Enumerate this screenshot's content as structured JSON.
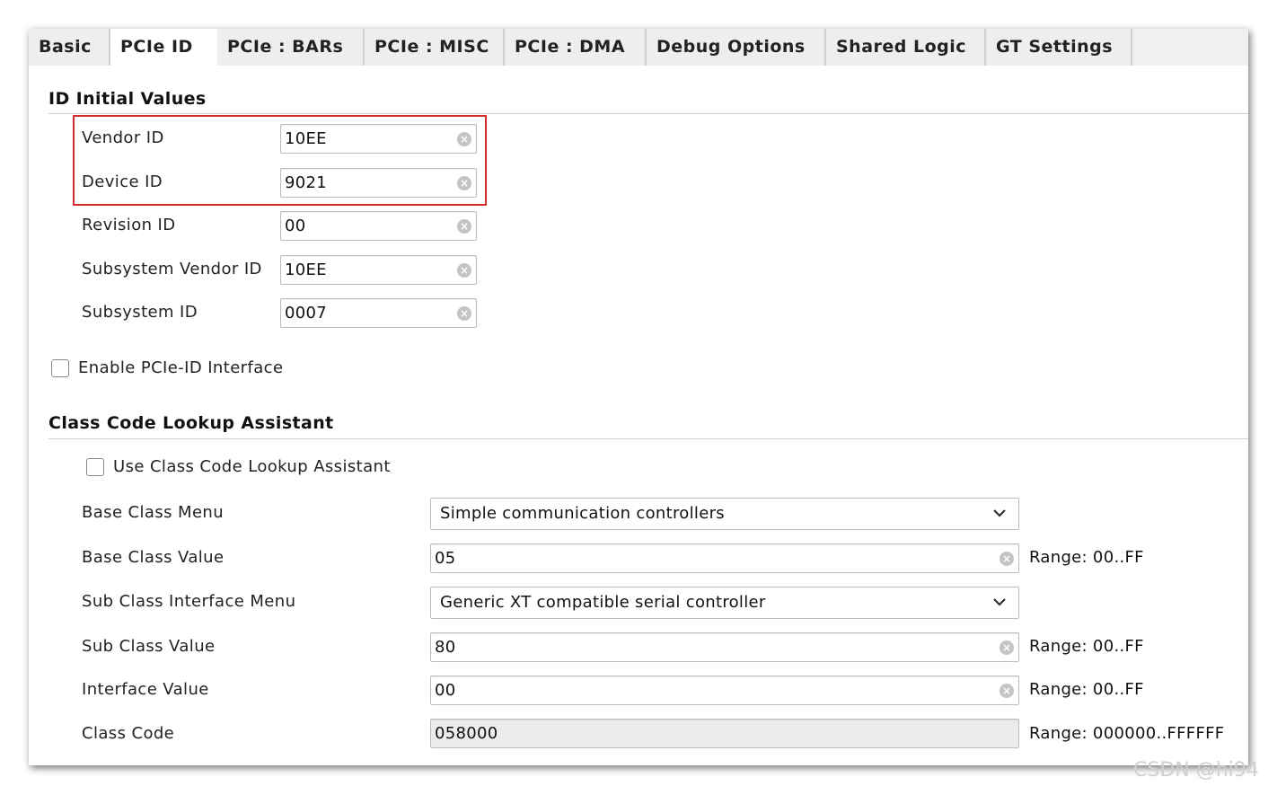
{
  "tabs": [
    "Basic",
    "PCIe ID",
    "PCIe : BARs",
    "PCIe : MISC",
    "PCIe : DMA",
    "Debug Options",
    "Shared Logic",
    "GT Settings"
  ],
  "id_section": {
    "title": "ID Initial Values",
    "vendor_id": {
      "label": "Vendor ID",
      "value": "10EE"
    },
    "device_id": {
      "label": "Device ID",
      "value": "9021"
    },
    "revision_id": {
      "label": "Revision ID",
      "value": "00"
    },
    "subsystem_vendor_id": {
      "label": "Subsystem Vendor ID",
      "value": "10EE"
    },
    "subsystem_id": {
      "label": "Subsystem ID",
      "value": "0007"
    }
  },
  "enable_pcie_id": {
    "label": "Enable PCIe-ID Interface",
    "checked": false
  },
  "class_section": {
    "title": "Class Code Lookup Assistant",
    "use_lookup": {
      "label": "Use Class Code Lookup Assistant",
      "checked": false
    },
    "base_class_menu": {
      "label": "Base Class Menu",
      "value": "Simple communication controllers"
    },
    "base_class_value": {
      "label": "Base Class Value",
      "value": "05",
      "range": "Range: 00..FF"
    },
    "sub_class_menu": {
      "label": "Sub Class Interface Menu",
      "value": "Generic XT compatible serial controller"
    },
    "sub_class_value": {
      "label": "Sub Class Value",
      "value": "80",
      "range": "Range: 00..FF"
    },
    "interface_value": {
      "label": "Interface Value",
      "value": "00",
      "range": "Range: 00..FF"
    },
    "class_code": {
      "label": "Class Code",
      "value": "058000",
      "range": "Range: 000000..FFFFFF"
    }
  },
  "watermark": "CSDN @hi94",
  "colors": {
    "highlight": "#d42a2a",
    "tabbar": "#f0f0f0"
  },
  "icons": {
    "clear": "clear-circle-icon",
    "dropdown": "chevron-down-icon"
  }
}
